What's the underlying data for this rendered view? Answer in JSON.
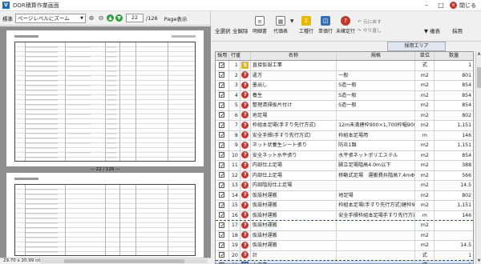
{
  "window": {
    "title": "DOR積算作業画面",
    "app_icon": "V",
    "close_label": "閉じる"
  },
  "left": {
    "toolbar": {
      "label": "標準",
      "zoom_value": "ページレベルにズーム",
      "page_current": "22",
      "page_total": "/126",
      "page_view_label": "Page表示"
    },
    "page_separator": "— 22 / 126 —",
    "status": "29.70 x 20.99 cm"
  },
  "right": {
    "toolbar": {
      "select_all": "全選択",
      "deselect_all": "全解除",
      "detail": "明細書",
      "item_table": "代価表",
      "process": "工種行",
      "unit_price": "単価行",
      "unexec": "未確定行",
      "restore_prev": "元に戻す",
      "redo": "やり直し",
      "copy": "複表",
      "adopt": "採用"
    },
    "lock_label": "採用エリア",
    "headers": {
      "check": "採用",
      "num": "行番号",
      "type": "",
      "name": "名称",
      "spec": "規格",
      "unit": "単位",
      "qty": "数量"
    },
    "rows": [
      {
        "checked": true,
        "num": "1",
        "icon": "S",
        "name": "直接仮設工事",
        "spec": "",
        "unit": "式",
        "qty": "1",
        "style": ""
      },
      {
        "checked": true,
        "num": "2",
        "icon": "?",
        "name": "遣方",
        "spec": "一般",
        "unit": "m2",
        "qty": "801",
        "style": ""
      },
      {
        "checked": true,
        "num": "3",
        "icon": "?",
        "name": "墨出し",
        "spec": "S造一般",
        "unit": "m2",
        "qty": "854",
        "style": ""
      },
      {
        "checked": true,
        "num": "4",
        "icon": "?",
        "name": "養生",
        "spec": "S造一般",
        "unit": "m2",
        "qty": "854",
        "style": ""
      },
      {
        "checked": true,
        "num": "5",
        "icon": "?",
        "name": "整理清掃後片付け",
        "spec": "S造一般",
        "unit": "m2",
        "qty": "854",
        "style": ""
      },
      {
        "checked": true,
        "num": "6",
        "icon": "?",
        "name": "地足場",
        "spec": "",
        "unit": "m2",
        "qty": "802",
        "style": ""
      },
      {
        "checked": true,
        "num": "7",
        "icon": "?",
        "name": "枠組本足場(手すり先行方式)",
        "spec": "12m未満建枠900×1,700枠幅900×240",
        "unit": "m2",
        "qty": "1,151",
        "style": ""
      },
      {
        "checked": true,
        "num": "8",
        "icon": "?",
        "name": "安全手摺(手すり先行方式)",
        "spec": "枠組本足場用",
        "unit": "m",
        "qty": "146",
        "style": ""
      },
      {
        "checked": true,
        "num": "9",
        "icon": "?",
        "name": "ネット状養生シート張り",
        "spec": "防炎1類",
        "unit": "m2",
        "qty": "1,151",
        "style": ""
      },
      {
        "checked": true,
        "num": "10",
        "icon": "?",
        "name": "安全ネット水平張り",
        "spec": "水平張ネットポリエステル",
        "unit": "m2",
        "qty": "854",
        "style": ""
      },
      {
        "checked": true,
        "num": "11",
        "icon": "?",
        "name": "内部仕上足場",
        "spec": "脚立足場階高4.0m以下",
        "unit": "m2",
        "qty": "388",
        "style": ""
      },
      {
        "checked": true,
        "num": "12",
        "icon": "?",
        "name": "内部仕上足場",
        "spec": "移動式足場　運搬費共階高7.4mΦ0.91m枠",
        "unit": "m2",
        "qty": "566",
        "style": ""
      },
      {
        "checked": true,
        "num": "13",
        "icon": "?",
        "name": "内部階段仕上足場",
        "spec": "",
        "unit": "m2",
        "qty": "14.5",
        "style": ""
      },
      {
        "checked": true,
        "num": "14",
        "icon": "?",
        "name": "仮設材運搬",
        "spec": "地足場",
        "unit": "m2",
        "qty": "802",
        "style": ""
      },
      {
        "checked": true,
        "num": "15",
        "icon": "?",
        "name": "仮設材運搬",
        "spec": "枠組本足場(手すり先行方式)建枠900×1.7",
        "unit": "m2",
        "qty": "1,151",
        "style": ""
      },
      {
        "checked": true,
        "num": "16",
        "icon": "?",
        "name": "仮設材運搬",
        "spec": "安全手摺枠組本足場手すり先行方式",
        "unit": "m",
        "qty": "146",
        "style": "dashed"
      },
      {
        "checked": true,
        "num": "17",
        "icon": "?",
        "name": "仮設材運搬",
        "spec": "",
        "unit": "m2",
        "qty": "",
        "style": ""
      },
      {
        "checked": true,
        "num": "18",
        "icon": "?",
        "name": "仮設材運搬",
        "spec": "",
        "unit": "m2",
        "qty": "",
        "style": ""
      },
      {
        "checked": true,
        "num": "19",
        "icon": "?",
        "name": "仮設材運搬",
        "spec": "",
        "unit": "m2",
        "qty": "14.5",
        "style": ""
      },
      {
        "checked": true,
        "num": "20",
        "icon": "?",
        "name": "計",
        "spec": "",
        "unit": "式",
        "qty": "1",
        "style": "dashed"
      },
      {
        "checked": true,
        "num": "21",
        "icon": "M",
        "name": "土工事",
        "spec": "",
        "unit": "式",
        "qty": "1",
        "style": "selected"
      }
    ]
  }
}
